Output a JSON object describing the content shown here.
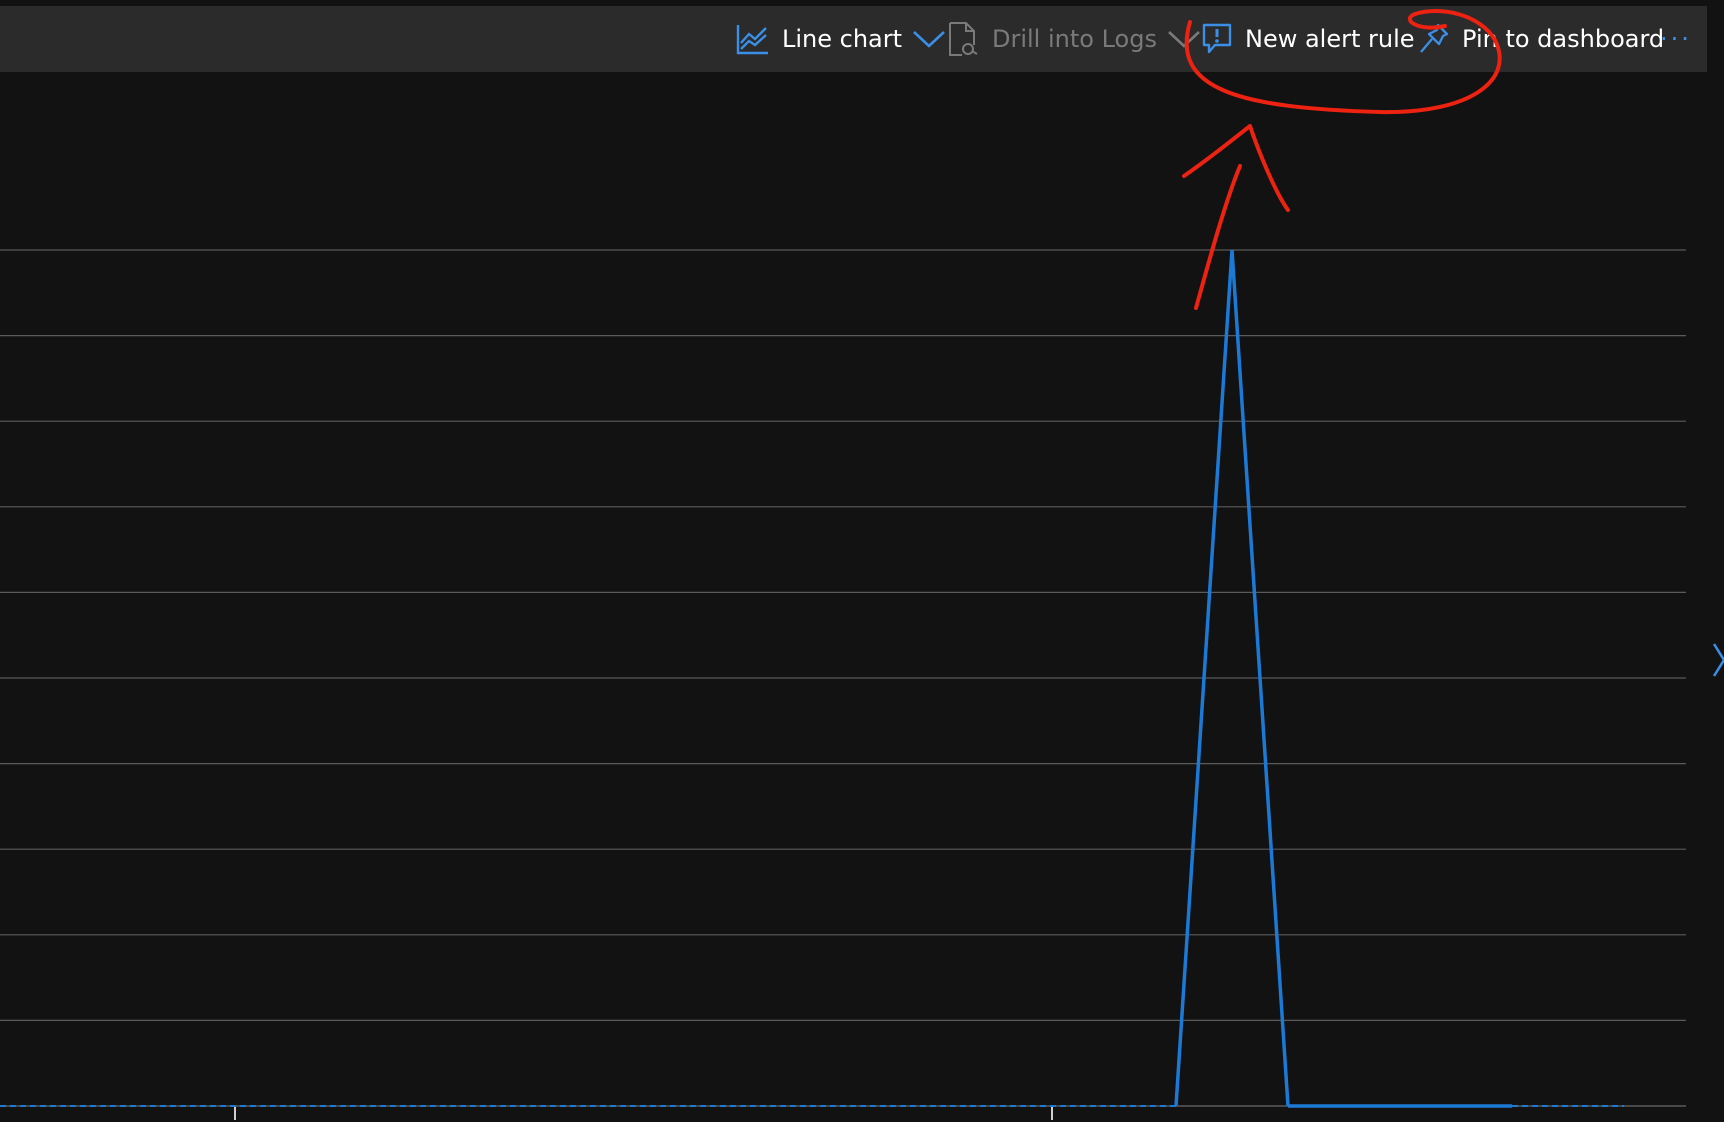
{
  "toolbar": {
    "chart_type_label": "Line chart",
    "drill_label": "Drill into Logs",
    "new_alert_label": "New alert rule",
    "pin_label": "Pin to dashboard",
    "more_label": "···"
  },
  "colors": {
    "background": "#121212",
    "toolbar_bg": "#2b2b2b",
    "accent": "#3b8fe6",
    "series": "#1c7ad6",
    "gridline": "#5a5a5a",
    "annotation": "#ee2211",
    "disabled_text": "#7a7a7a"
  },
  "icons": {
    "chart_type": "line-chart-icon",
    "drill": "drill-logs-icon",
    "new_alert": "alert-icon",
    "pin": "pin-icon",
    "more": "more-dots-icon",
    "side": "chevron-right-icon"
  },
  "chart_data": {
    "type": "line",
    "grid": true,
    "gridline_count": 11,
    "x": [
      0,
      1,
      2,
      3,
      4,
      5,
      6,
      7,
      8,
      9,
      10,
      11,
      12,
      13,
      14,
      15,
      16,
      17,
      18,
      19,
      20,
      21,
      22,
      23,
      24,
      25,
      26,
      27,
      28,
      29
    ],
    "series": [
      {
        "values": [
          0,
          0,
          0,
          0,
          0,
          0,
          0,
          0,
          0,
          0,
          0,
          0,
          0,
          0,
          0,
          0,
          0,
          0,
          0,
          0,
          0,
          0,
          10,
          0,
          0,
          0,
          0,
          0,
          0,
          0
        ]
      }
    ],
    "ylim": [
      0,
      11
    ]
  }
}
